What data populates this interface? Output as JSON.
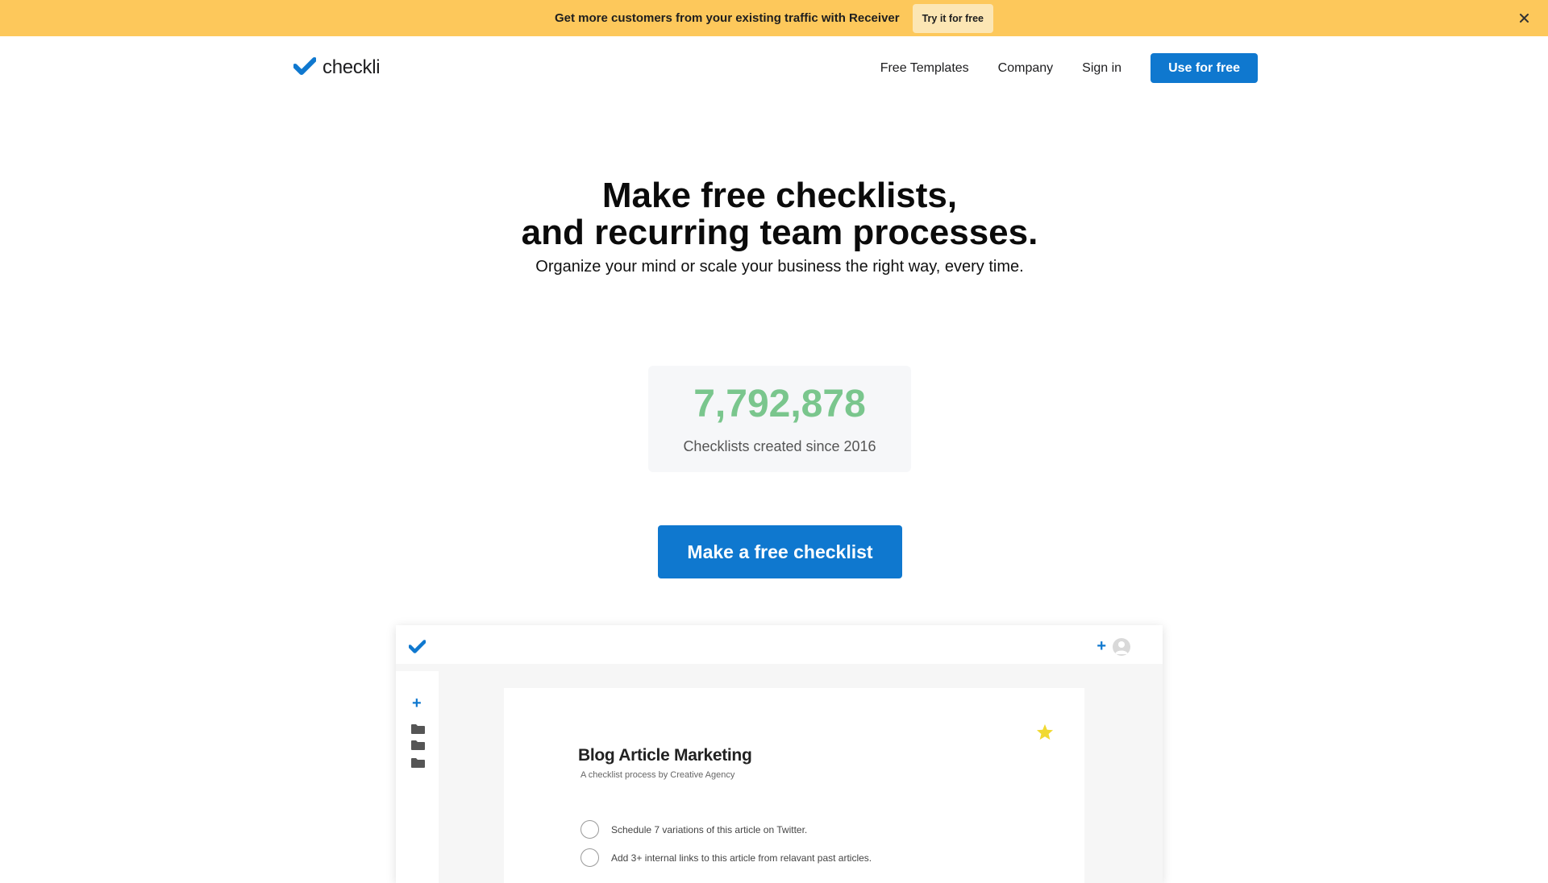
{
  "banner": {
    "text": "Get more customers from your existing traffic with Receiver",
    "button": "Try it for free",
    "close_icon": "close-icon"
  },
  "brand": {
    "name": "checkli",
    "logo_icon": "checkmark-logo-icon",
    "color": "#0f78cf"
  },
  "nav": {
    "links": [
      "Free Templates",
      "Company",
      "Sign in"
    ],
    "cta": "Use for free"
  },
  "hero": {
    "title_line1": "Make free checklists,",
    "title_line2": "and recurring team processes.",
    "subtitle": "Organize your mind or scale your business the right way, every time."
  },
  "stat": {
    "number": "7,792,878",
    "label": "Checklists created since 2016",
    "color": "#7ac68d"
  },
  "cta": {
    "label": "Make a free checklist"
  },
  "preview": {
    "add_icon": "plus-icon",
    "avatar_icon": "user-avatar-icon",
    "sidebar_icons": [
      "plus-icon",
      "folder-icon",
      "folder-icon",
      "folder-icon"
    ],
    "card": {
      "title": "Blog Article Marketing",
      "subtitle": "A checklist process by Creative Agency",
      "star_icon": "star-icon",
      "tasks": [
        "Schedule 7 variations of this article on Twitter.",
        "Add 3+ internal links to this article from relavant past articles."
      ]
    }
  }
}
